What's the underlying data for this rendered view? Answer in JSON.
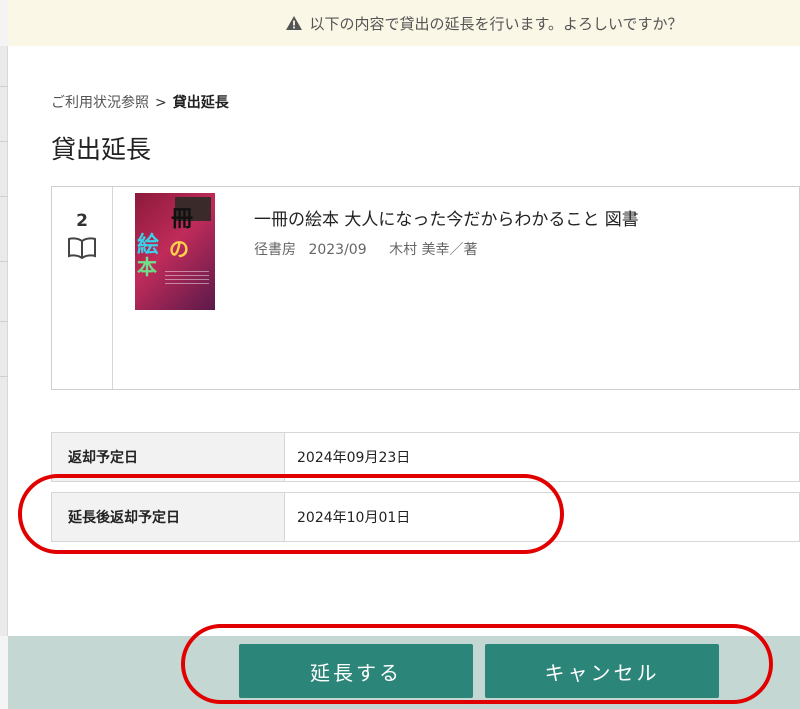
{
  "banner": {
    "icon": "warning-icon",
    "message": "以下の内容で貸出の延長を行います。よろしいですか？"
  },
  "breadcrumb": {
    "parent": "ご利用状況参照",
    "separator": ">",
    "current": "貸出延長"
  },
  "page": {
    "title": "貸出延長"
  },
  "item": {
    "number": "2",
    "type_icon": "book-icon",
    "title": "一冊の絵本 大人になった今だからわかること 図書",
    "publisher": "径書房",
    "date": "2023/09",
    "author": "木村 美幸／著"
  },
  "dates": {
    "due_label": "返却予定日",
    "due_value": "2024年09月23日",
    "extended_label": "延長後返却予定日",
    "extended_value": "2024年10月01日"
  },
  "actions": {
    "extend_label": "延長する",
    "cancel_label": "キャンセル"
  },
  "colors": {
    "button": "#2b8579",
    "footer": "#c5d7d3",
    "banner": "#fbf7e6",
    "annotation": "#e10000"
  }
}
